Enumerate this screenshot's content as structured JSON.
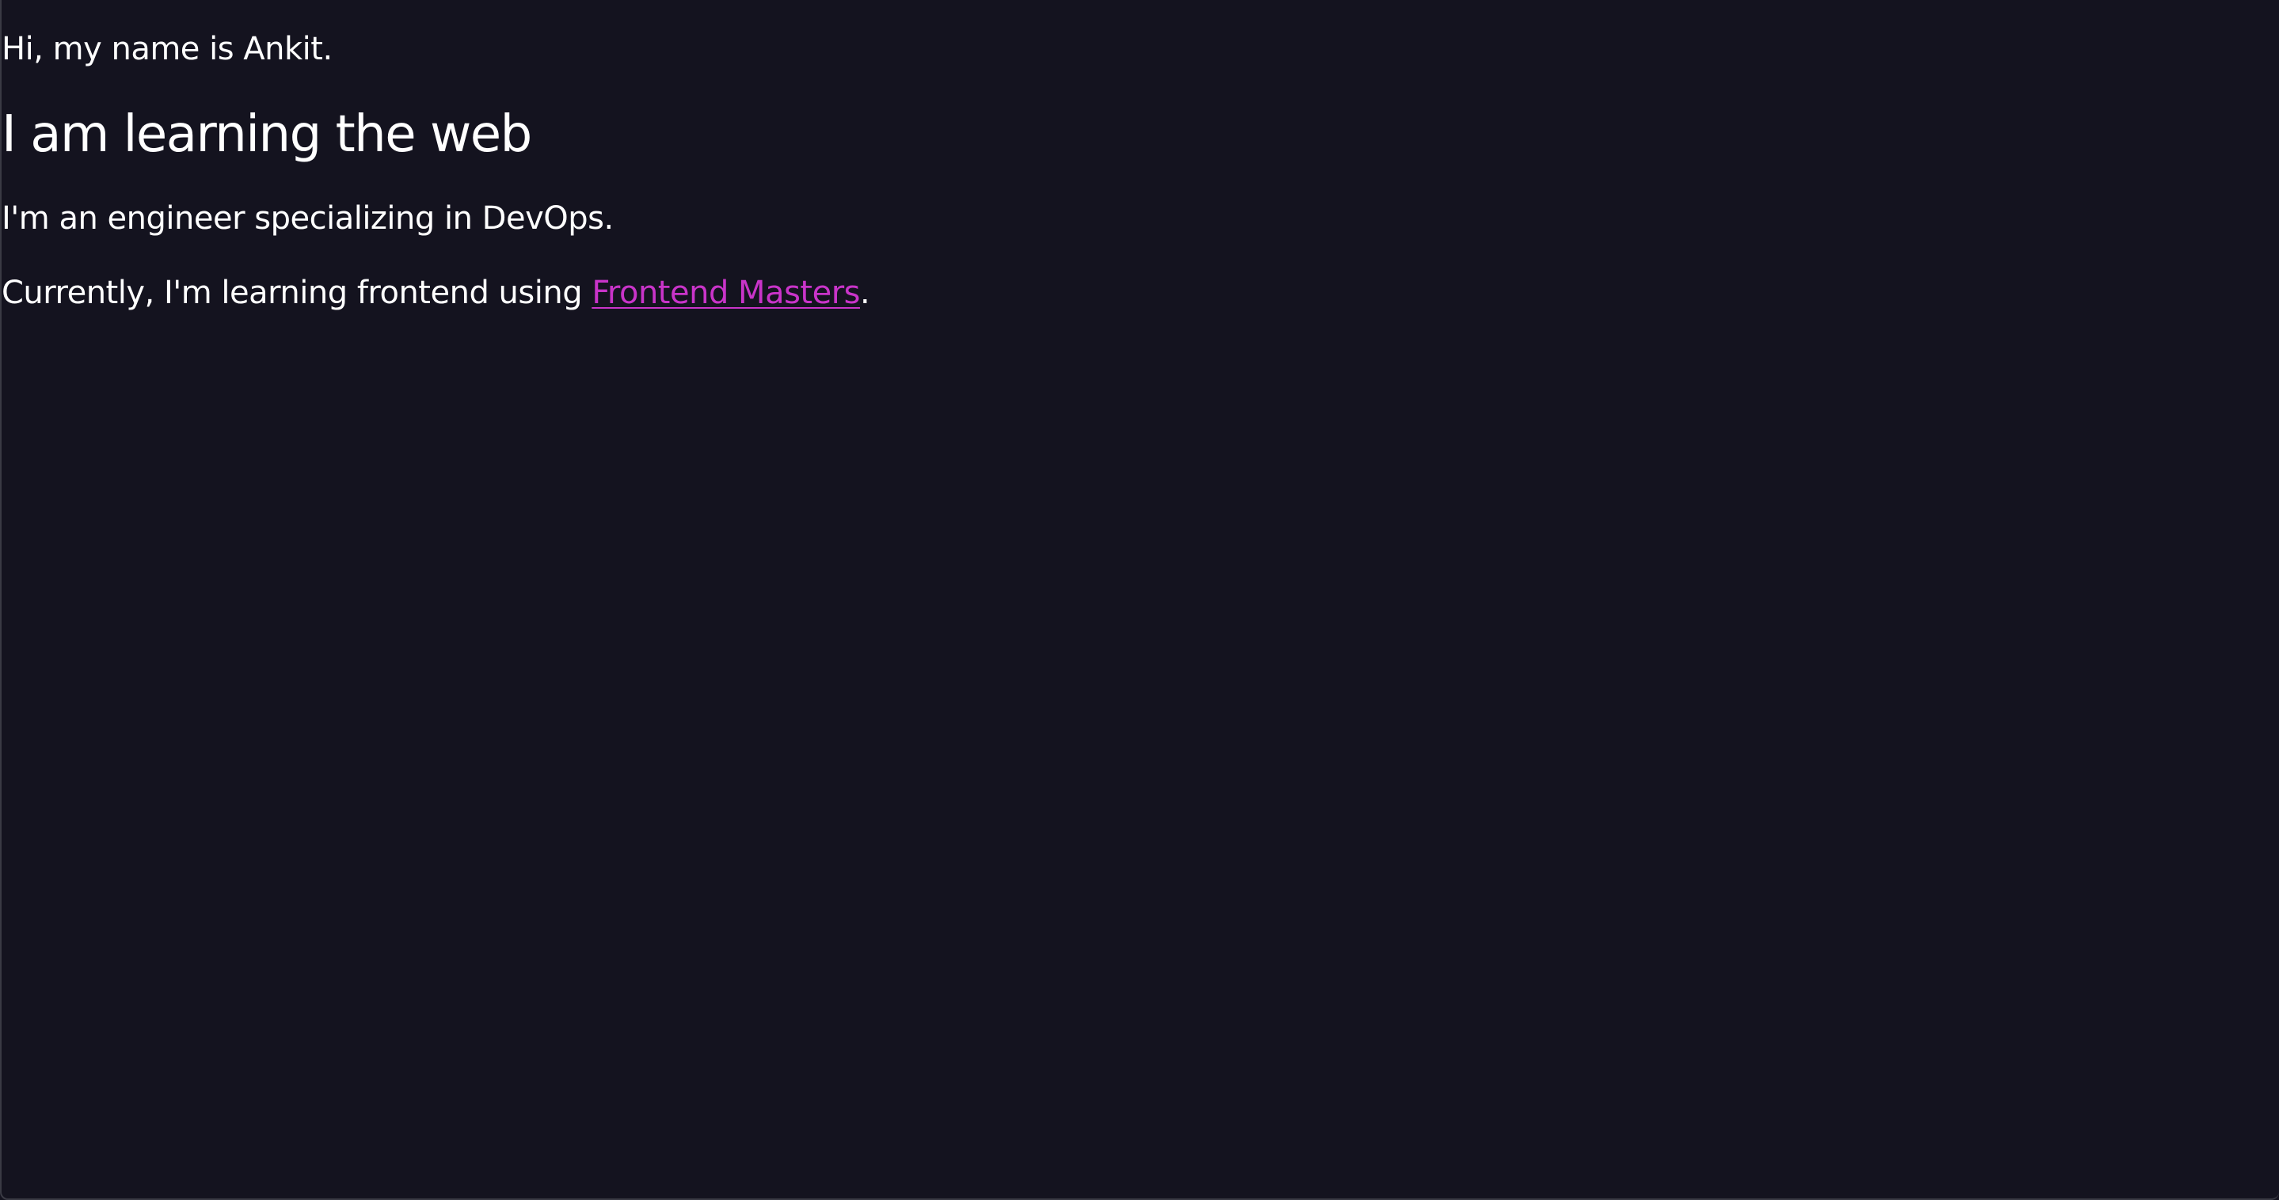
{
  "intro": {
    "greeting": "Hi, my name is Ankit."
  },
  "hero": {
    "title": "I am learning the web"
  },
  "about": {
    "role": "I'm an engineer specializing in DevOps.",
    "learning_prefix": "Currently, I'm learning frontend using ",
    "learning_link": "Frontend Masters",
    "learning_suffix": "."
  },
  "colors": {
    "background": "#14131f",
    "text": "#ffffff",
    "link": "#c934c9"
  }
}
